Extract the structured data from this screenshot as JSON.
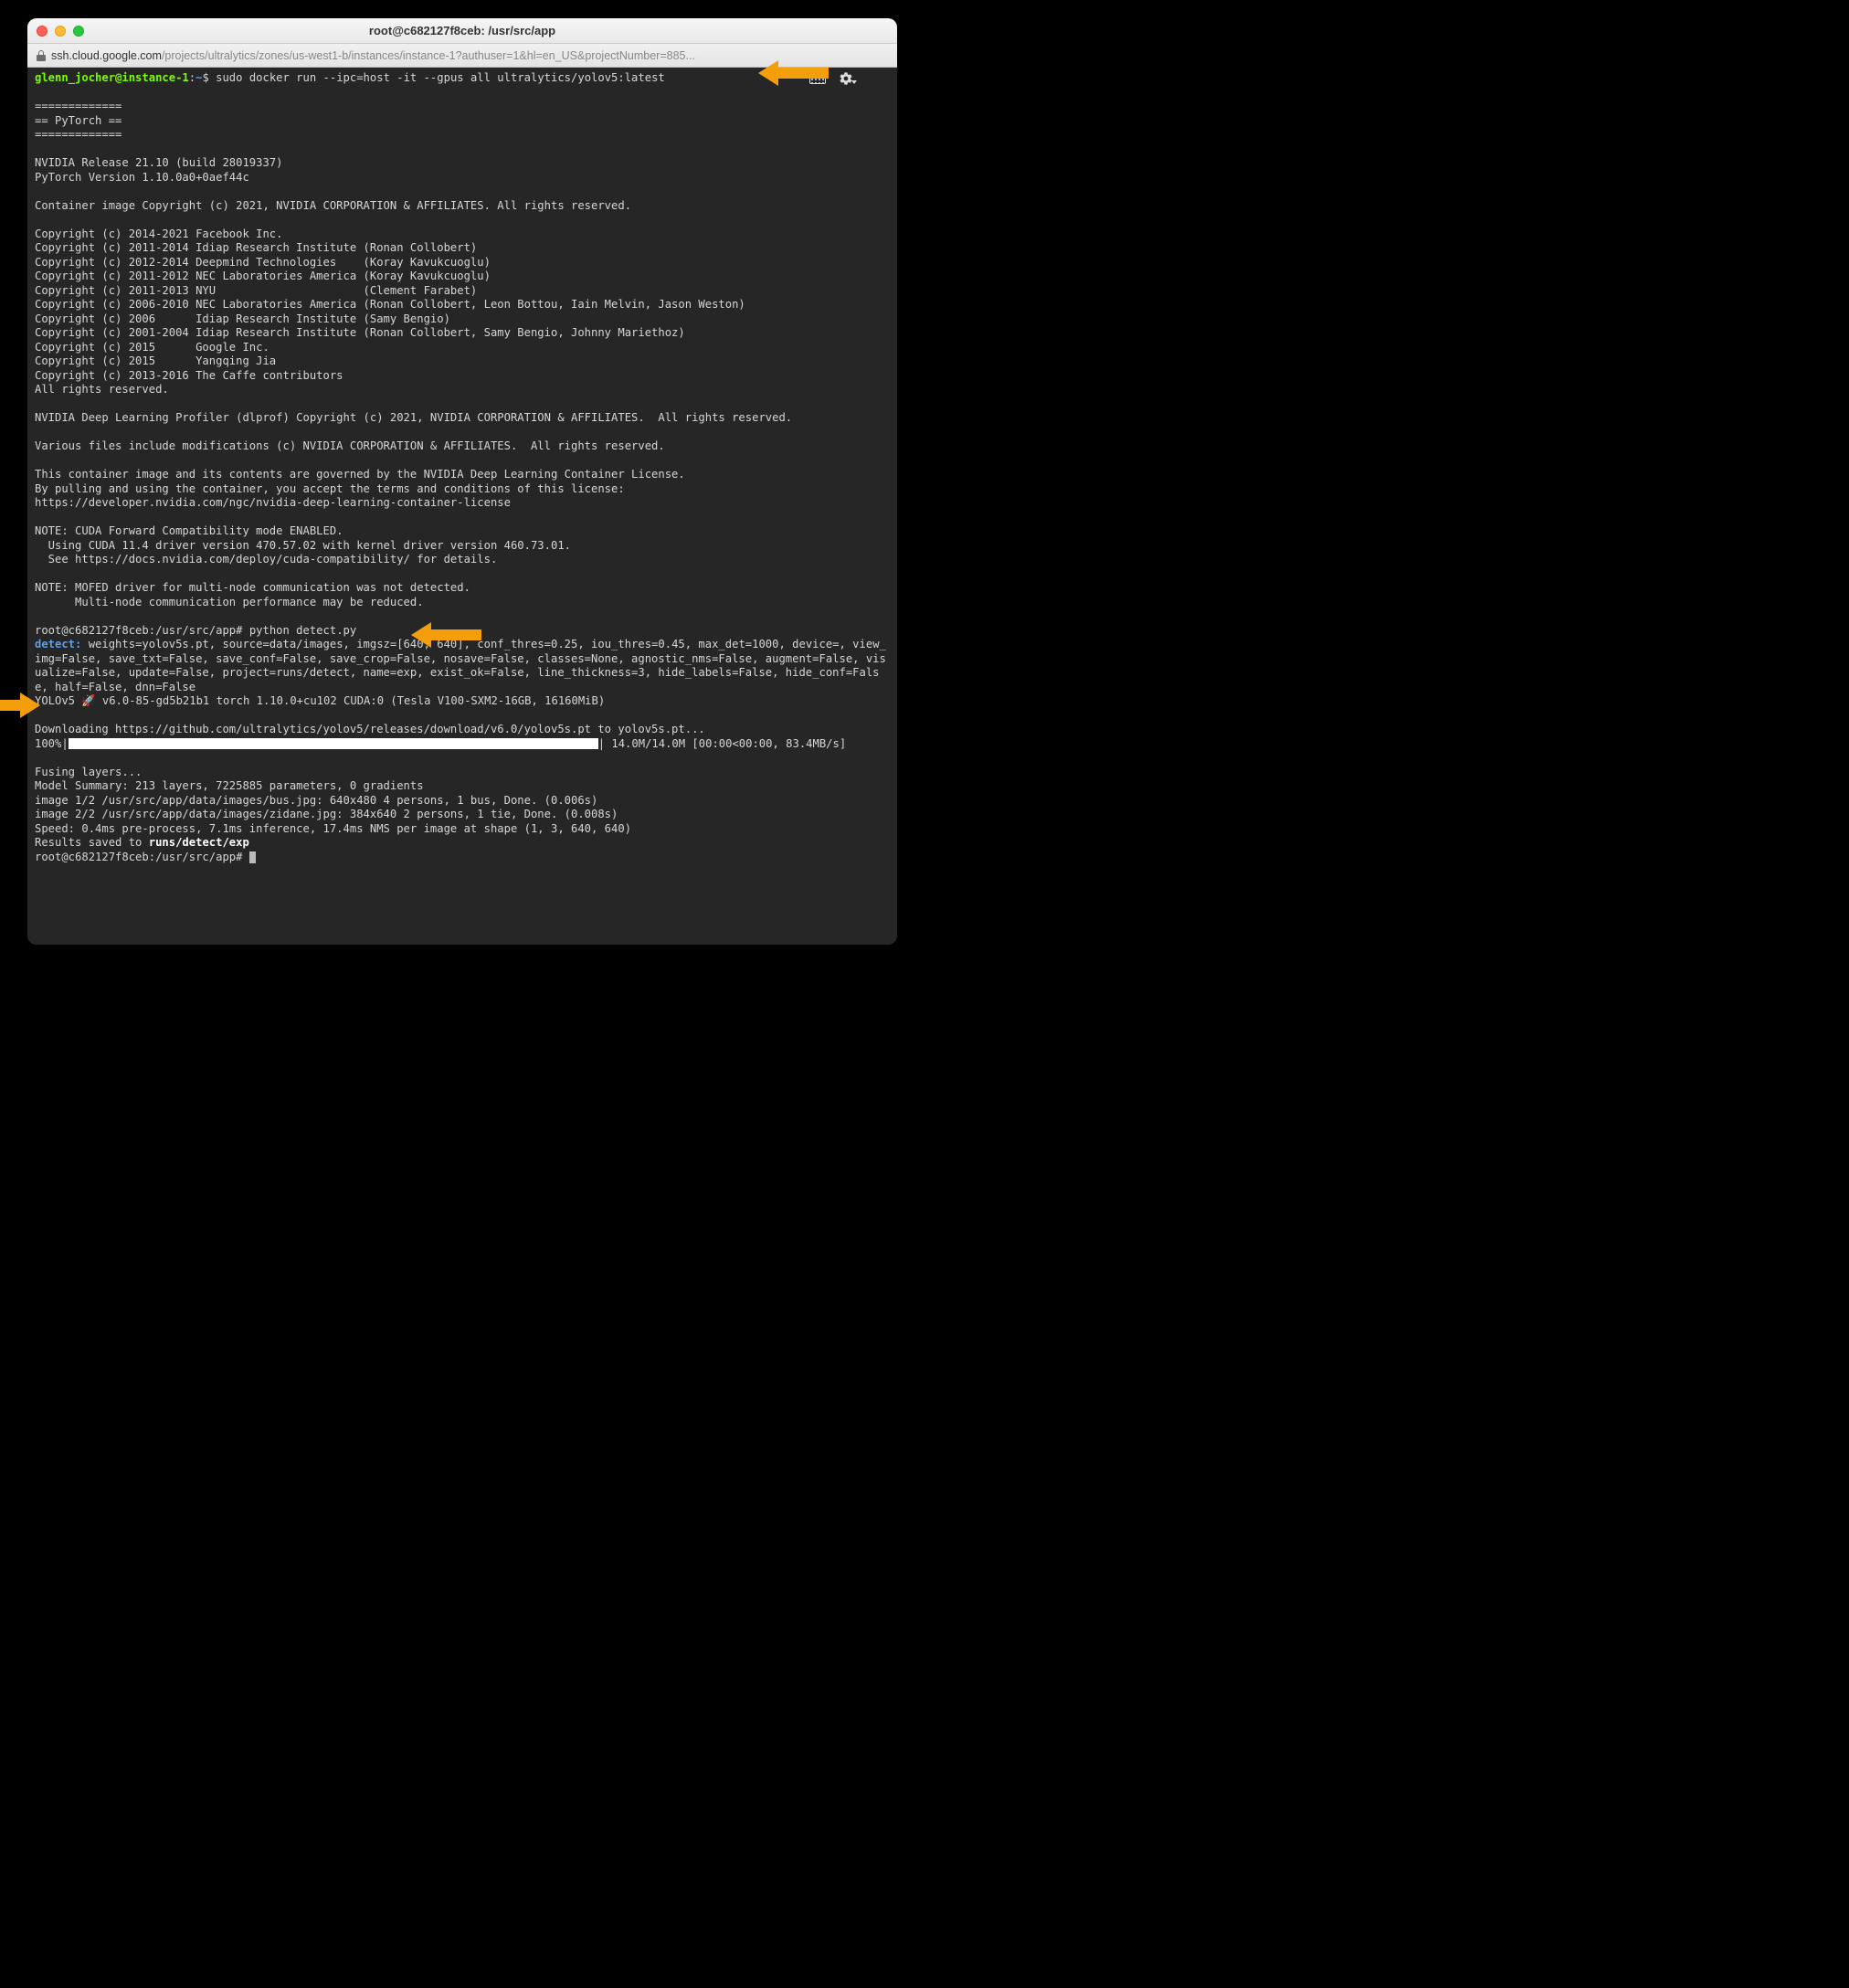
{
  "window": {
    "title": "root@c682127f8ceb: /usr/src/app"
  },
  "url": {
    "host": "ssh.cloud.google.com",
    "path": "/projects/ultralytics/zones/us-west1-b/instances/instance-1?authuser=1&hl=en_US&projectNumber=885..."
  },
  "prompt1": {
    "user_host": "glenn_jocher@instance-1",
    "sep": ":",
    "path": "~",
    "sym": "$",
    "cmd": " sudo docker run --ipc=host -it --gpus all ultralytics/yolov5:latest"
  },
  "banner": {
    "l1": "=============",
    "l2": "== PyTorch ==",
    "l3": "=============",
    "nv1": "NVIDIA Release 21.10 (build 28019337)",
    "nv2": "PyTorch Version 1.10.0a0+0aef44c",
    "cimg": "Container image Copyright (c) 2021, NVIDIA CORPORATION & AFFILIATES. All rights reserved.",
    "c1": "Copyright (c) 2014-2021 Facebook Inc.",
    "c2": "Copyright (c) 2011-2014 Idiap Research Institute (Ronan Collobert)",
    "c3": "Copyright (c) 2012-2014 Deepmind Technologies    (Koray Kavukcuoglu)",
    "c4": "Copyright (c) 2011-2012 NEC Laboratories America (Koray Kavukcuoglu)",
    "c5": "Copyright (c) 2011-2013 NYU                      (Clement Farabet)",
    "c6": "Copyright (c) 2006-2010 NEC Laboratories America (Ronan Collobert, Leon Bottou, Iain Melvin, Jason Weston)",
    "c7": "Copyright (c) 2006      Idiap Research Institute (Samy Bengio)",
    "c8": "Copyright (c) 2001-2004 Idiap Research Institute (Ronan Collobert, Samy Bengio, Johnny Mariethoz)",
    "c9": "Copyright (c) 2015      Google Inc.",
    "c10": "Copyright (c) 2015      Yangqing Jia",
    "c11": "Copyright (c) 2013-2016 The Caffe contributors",
    "c12": "All rights reserved.",
    "dlp": "NVIDIA Deep Learning Profiler (dlprof) Copyright (c) 2021, NVIDIA CORPORATION & AFFILIATES.  All rights reserved.",
    "var": "Various files include modifications (c) NVIDIA CORPORATION & AFFILIATES.  All rights reserved.",
    "lic1": "This container image and its contents are governed by the NVIDIA Deep Learning Container License.",
    "lic2": "By pulling and using the container, you accept the terms and conditions of this license:",
    "lic3": "https://developer.nvidia.com/ngc/nvidia-deep-learning-container-license",
    "note1a": "NOTE: CUDA Forward Compatibility mode ENABLED.",
    "note1b": "  Using CUDA 11.4 driver version 470.57.02 with kernel driver version 460.73.01.",
    "note1c": "  See https://docs.nvidia.com/deploy/cuda-compatibility/ for details.",
    "note2a": "NOTE: MOFED driver for multi-node communication was not detected.",
    "note2b": "      Multi-node communication performance may be reduced."
  },
  "prompt2": {
    "prefix": "root@c682127f8ceb:/usr/src/app# ",
    "cmd": "python detect.py"
  },
  "detect": {
    "label": "detect:",
    "args": " weights=yolov5s.pt, source=data/images, imgsz=[640, 640], conf_thres=0.25, iou_thres=0.45, max_det=1000, device=, view_img=False, save_txt=False, save_conf=False, save_crop=False, nosave=False, classes=None, agnostic_nms=False, augment=False, visualize=False, update=False, project=runs/detect, name=exp, exist_ok=False, line_thickness=3, hide_labels=False, hide_conf=False, half=False, dnn=False"
  },
  "yolo": {
    "line": "YOLOv5 🚀 v6.0-85-gd5b21b1 torch 1.10.0+cu102 CUDA:0 (Tesla V100-SXM2-16GB, 16160MiB)"
  },
  "download": {
    "line": "Downloading https://github.com/ultralytics/yolov5/releases/download/v6.0/yolov5s.pt to yolov5s.pt...",
    "pct": "100%",
    "tail": " 14.0M/14.0M [00:00<00:00, 83.4MB/s]"
  },
  "results": {
    "fuse": "Fusing layers...",
    "summary": "Model Summary: 213 layers, 7225885 parameters, 0 gradients",
    "img1": "image 1/2 /usr/src/app/data/images/bus.jpg: 640x480 4 persons, 1 bus, Done. (0.006s)",
    "img2": "image 2/2 /usr/src/app/data/images/zidane.jpg: 384x640 2 persons, 1 tie, Done. (0.008s)",
    "speed": "Speed: 0.4ms pre-process, 7.1ms inference, 17.4ms NMS per image at shape (1, 3, 640, 640)",
    "saved_prefix": "Results saved to ",
    "saved_path": "runs/detect/exp"
  },
  "prompt3": "root@c682127f8ceb:/usr/src/app# "
}
